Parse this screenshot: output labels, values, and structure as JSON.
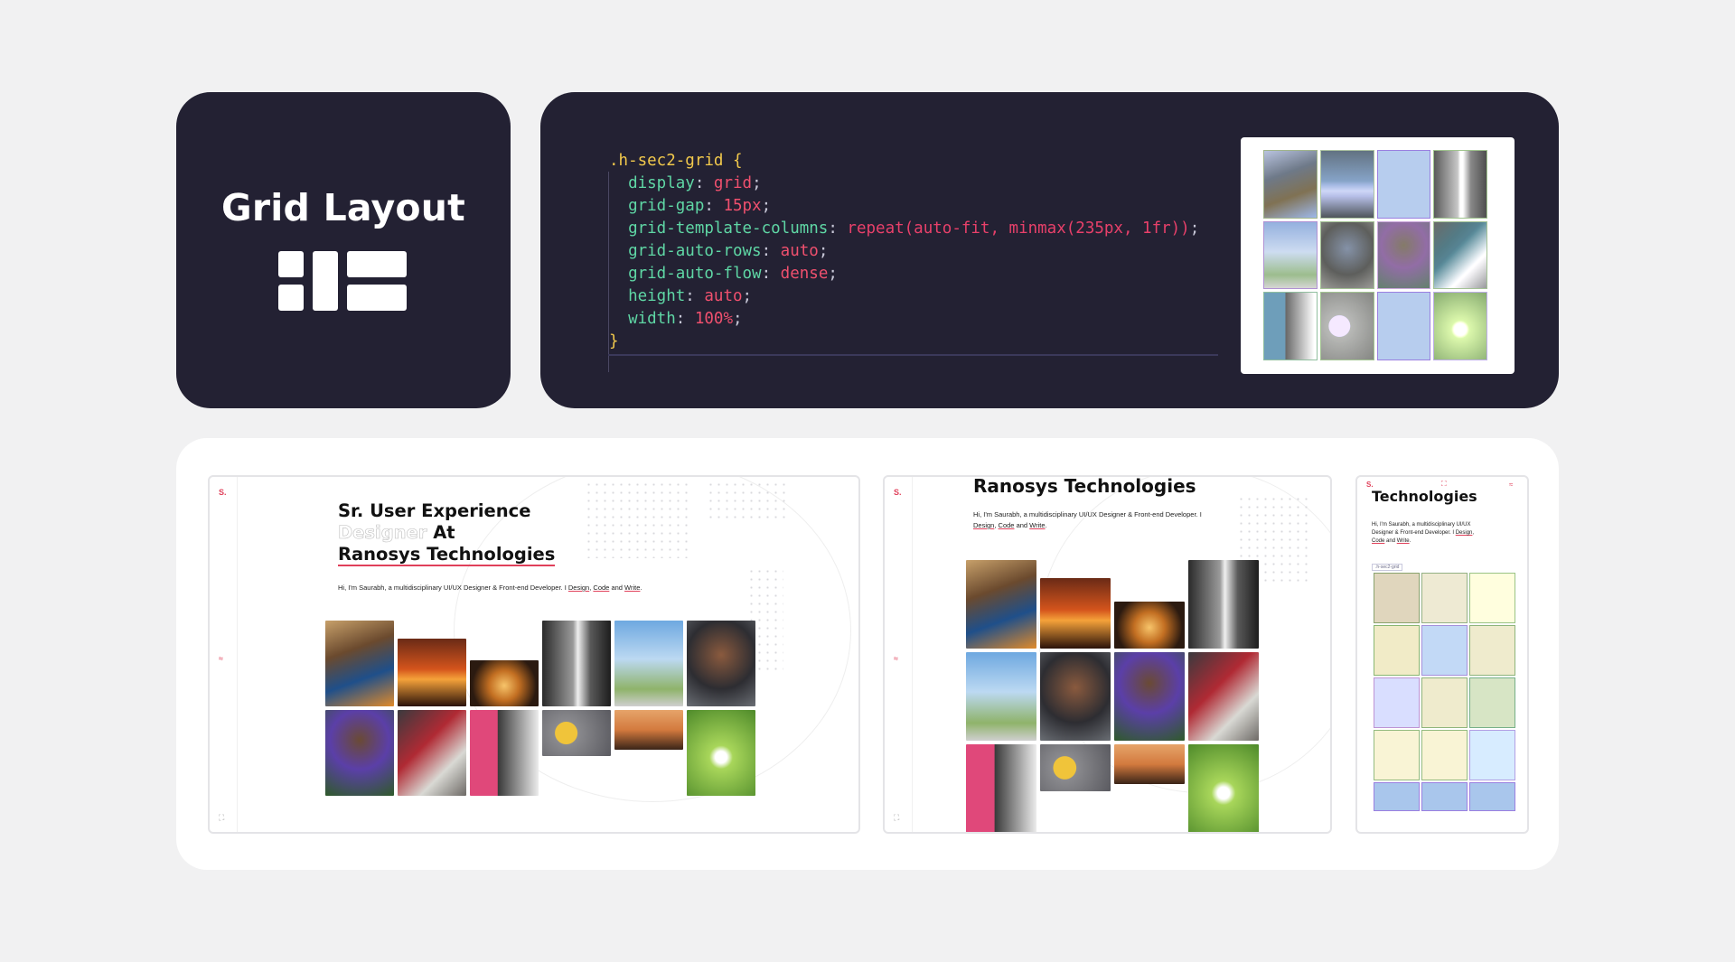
{
  "title_card": {
    "title": "Grid Layout",
    "icon": "grid-layout-icon"
  },
  "code": {
    "selector": ".h-sec2-grid",
    "open_brace": "{",
    "close_brace": "}",
    "lines": [
      {
        "prop": "display",
        "value": "grid"
      },
      {
        "prop": "grid-gap",
        "value": "15px"
      },
      {
        "prop": "grid-template-columns",
        "value": "repeat(auto-fit, minmax(235px, 1fr))"
      },
      {
        "prop": "grid-auto-rows",
        "value": "auto"
      },
      {
        "prop": "grid-auto-flow",
        "value": "dense"
      },
      {
        "prop": "height",
        "value": "auto"
      },
      {
        "prop": "width",
        "value": "100%"
      }
    ]
  },
  "showcase": {
    "logo": "S.",
    "desktop": {
      "title_line1": "Sr. User Experience",
      "title_line2_ghost": "Designer",
      "title_line2_rest": "At",
      "title_line3": "Ranosys Technologies",
      "subtitle_prefix": "Hi, I'm Saurabh, a multidisciplinary UI/UX Designer & Front-end Developer. I ",
      "design": "Design",
      "code": "Code",
      "and": "and",
      "write": "Write",
      "comma": ", ",
      "period": "."
    },
    "tablet": {
      "title": "Ranosys Technologies",
      "subtitle_line1": "Hi, I'm Saurabh, a multidisciplinary UI/UX Designer & Front-end Developer. I",
      "design": "Design",
      "code": "Code",
      "and": "and",
      "write": "Write"
    },
    "mobile": {
      "title": "Technologies",
      "subtitle_line1": "Hi, I'm Saurabh, a multidisciplinary UI/UX",
      "subtitle_line2": "Designer & Front-end Developer. I",
      "design": "Design",
      "code": "Code",
      "and": "and",
      "write": "Write",
      "grid_label": ".h-sec2-grid"
    }
  }
}
